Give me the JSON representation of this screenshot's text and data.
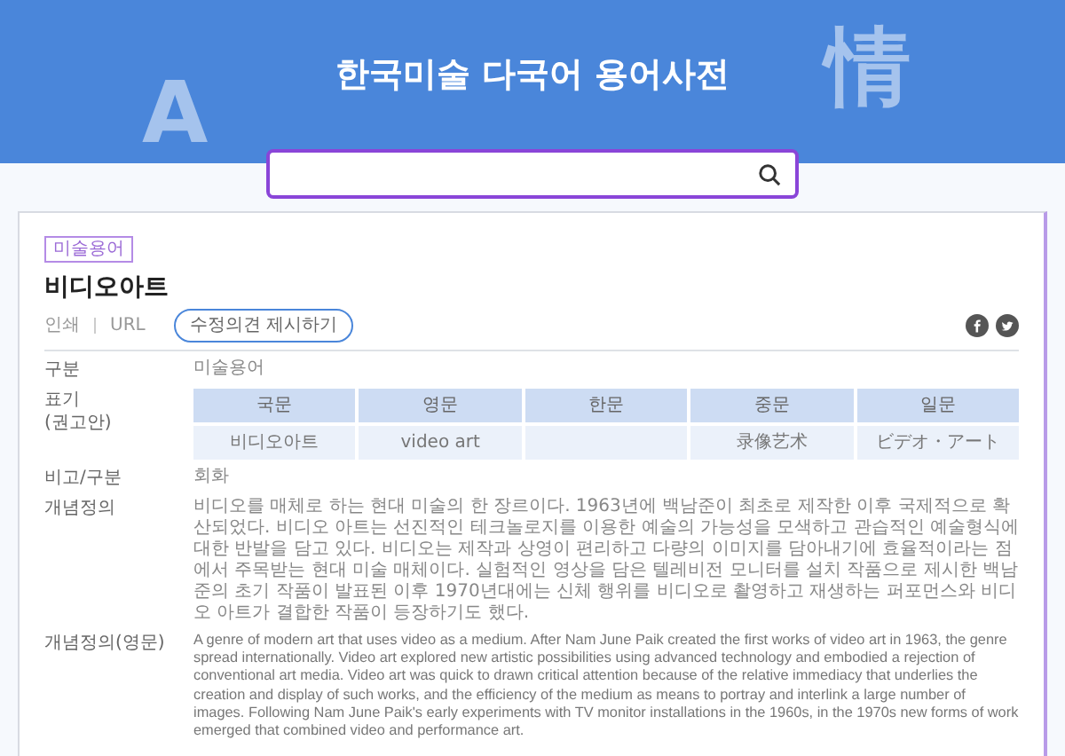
{
  "header": {
    "title": "한국미술 다국어 용어사전",
    "background_letters": [
      "A",
      "情"
    ]
  },
  "entry": {
    "tag": "미술용어",
    "title": "비디오아트",
    "actions": [
      {
        "kind": "link",
        "label": "인쇄"
      },
      {
        "kind": "link",
        "label": "URL"
      },
      {
        "kind": "button",
        "label": "수정의견 제시하기"
      }
    ],
    "share": [
      {
        "kind": "facebook"
      },
      {
        "kind": "twitter"
      }
    ],
    "fields": [
      {
        "kind": "text",
        "label": "구분",
        "value": "미술용어"
      },
      {
        "kind": "table",
        "label": "표기\n(권고안)",
        "columns": [
          {
            "header": "국문",
            "value": "비디오아트"
          },
          {
            "header": "영문",
            "value": "video art"
          },
          {
            "header": "한문"
          },
          {
            "header": "중문",
            "value": "录像艺术"
          },
          {
            "header": "일문",
            "value": "ビデオ・アート"
          }
        ]
      },
      {
        "kind": "text",
        "label": "비고/구분",
        "value": "회화"
      },
      {
        "kind": "text",
        "label": "개념정의",
        "value": "비디오를 매체로 하는 현대 미술의 한 장르이다. 1963년에 백남준이 최초로 제작한 이후 국제적으로 확산되었다. 비디오 아트는 선진적인 테크놀로지를 이용한 예술의 가능성을 모색하고 관습적인 예술형식에 대한 반발을 담고 있다. 비디오는 제작과 상영이 편리하고 다량의 이미지를 담아내기에 효율적이라는 점에서 주목받는 현대 미술 매체이다. 실험적인 영상을 담은 텔레비전 모니터를 설치 작품으로 제시한 백남준의 초기 작품이 발표된 이후 1970년대에는 신체 행위를 비디오로 촬영하고 재생하는 퍼포먼스와 비디오 아트가 결합한 작품이 등장하기도 했다."
      },
      {
        "kind": "english",
        "label": "개념정의(영문)",
        "value": "A genre of modern art that uses video as a medium. After Nam June Paik created the first works of video art in 1963, the genre spread internationally. Video art explored new artistic possibilities using advanced technology and embodied a rejection of conventional art media. Video art was quick to drawn critical attention because of the relative immediacy that underlies the creation and display of such works, and the efficiency of the medium as means to portray and interlink a large number of images. Following Nam June Paik's early experiments with TV monitor installations in the 1960s, in the 1970s new forms of work emerged that combined video and performance art."
      }
    ]
  }
}
